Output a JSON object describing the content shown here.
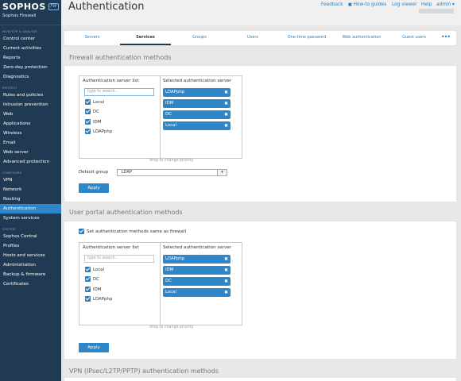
{
  "app": {
    "logo": "SOPHOS",
    "logo_badge": "FW",
    "subtitle": "Sophos Firewall"
  },
  "sidebar": {
    "sections": [
      {
        "title": "MONITOR & ANALYZE",
        "items": [
          "Control center",
          "Current activities",
          "Reports",
          "Zero-day protection",
          "Diagnostics"
        ]
      },
      {
        "title": "PROTECT",
        "items": [
          "Rules and policies",
          "Intrusion prevention",
          "Web",
          "Applications",
          "Wireless",
          "Email",
          "Web server",
          "Advanced protection"
        ]
      },
      {
        "title": "CONFIGURE",
        "items": [
          "VPN",
          "Network",
          "Routing",
          "Authentication",
          "System services"
        ]
      },
      {
        "title": "SYSTEM",
        "items": [
          "Sophos Central",
          "Profiles",
          "Hosts and services",
          "Administration",
          "Backup & firmware",
          "Certificates"
        ]
      }
    ],
    "active_item": "Authentication"
  },
  "header": {
    "title": "Authentication",
    "links": {
      "feedback": "Feedback",
      "how_to": "How-to guides",
      "log_viewer": "Log viewer",
      "help": "Help",
      "admin": "admin ▾"
    }
  },
  "tabs": {
    "items": [
      "Servers",
      "Services",
      "Groups",
      "Users",
      "One-time password",
      "Web authentication",
      "Guest users"
    ],
    "active": "Services",
    "more": "•••"
  },
  "firewall_auth": {
    "section_title": "Firewall authentication methods",
    "server_list_title": "Authentication server list",
    "search_placeholder": "type to search...",
    "server_list": [
      "Local",
      "DC",
      "IDM",
      "LDAPphp"
    ],
    "selected_title": "Selected authentication server",
    "selected": [
      "LDAPphp",
      "IDM",
      "DC",
      "Local"
    ],
    "drag_hint": "drag to change priority",
    "default_group_label": "Default group",
    "default_group_value": "LDAP",
    "apply": "Apply"
  },
  "user_portal": {
    "section_title": "User portal authentication methods",
    "same_as_firewall_label": "Set authentication methods same as firewall",
    "server_list_title": "Authentication server list",
    "search_placeholder": "type to search...",
    "server_list": [
      "Local",
      "DC",
      "IDM",
      "LDAPphp"
    ],
    "selected_title": "Selected authentication server",
    "selected": [
      "LDAPphp",
      "IDM",
      "DC",
      "Local"
    ],
    "drag_hint": "drag to change priority",
    "apply": "Apply"
  },
  "vpn_auth": {
    "section_title": "VPN (IPsec/L2TP/PPTP) authentication methods"
  },
  "colors": {
    "sidebar_bg": "#1f3a52",
    "accent": "#2e86c8",
    "link": "#2a7fc0"
  }
}
